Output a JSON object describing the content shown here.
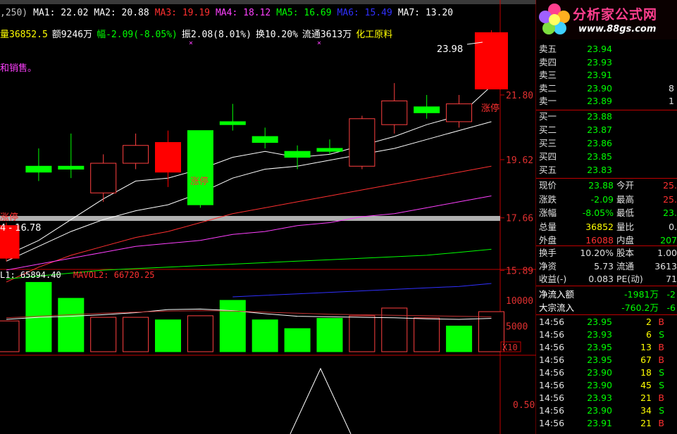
{
  "header": {
    "ma_items": [
      {
        "text": ",250)",
        "color": "#c0c0c0"
      },
      {
        "text": "MA1: 22.02",
        "color": "#ffffff"
      },
      {
        "text": "MA2: 20.88",
        "color": "#ffffff"
      },
      {
        "text": "MA3: 19.19",
        "color": "#ff3030"
      },
      {
        "text": "MA4: 18.12",
        "color": "#ff40ff"
      },
      {
        "text": "MA5: 16.69",
        "color": "#00ff00"
      },
      {
        "text": "MA6: 15.49",
        "color": "#3030ff"
      },
      {
        "text": "MA7: 13.20",
        "color": "#ffffff"
      }
    ],
    "info_items": [
      {
        "text": "量36852.5",
        "color": "#ffff00"
      },
      {
        "text": "额9246万",
        "color": "#ffffff"
      },
      {
        "text": "幅-2.09(-8.05%)",
        "color": "#00ff00"
      },
      {
        "text": "振2.08(8.01%)",
        "color": "#ffffff"
      },
      {
        "text": "换10.20%",
        "color": "#ffffff"
      },
      {
        "text": "流通3613万",
        "color": "#ffffff"
      },
      {
        "text": "化工原料",
        "color": "#ffff00"
      }
    ],
    "note": "和销售。"
  },
  "chart_data": {
    "type": "candlestick",
    "y_ticks": [
      "21.80",
      "19.62",
      "17.66",
      "15.89"
    ],
    "candles": [
      {
        "o": 17.4,
        "c": 16.3,
        "h": 17.5,
        "l": 16.2
      },
      {
        "o": 19.2,
        "c": 19.4,
        "h": 20.0,
        "l": 18.9
      },
      {
        "o": 19.3,
        "c": 19.4,
        "h": 20.5,
        "l": 19.0
      },
      {
        "o": 18.5,
        "c": 19.5,
        "h": 19.8,
        "l": 18.2
      },
      {
        "o": 19.5,
        "c": 20.1,
        "h": 20.5,
        "l": 19.3
      },
      {
        "o": 20.2,
        "c": 19.2,
        "h": 20.6,
        "l": 18.7
      },
      {
        "o": 18.1,
        "c": 20.6,
        "h": 20.6,
        "l": 18.0
      },
      {
        "o": 20.8,
        "c": 20.9,
        "h": 21.5,
        "l": 20.6
      },
      {
        "o": 20.4,
        "c": 20.2,
        "h": 20.7,
        "l": 20.0
      },
      {
        "o": 19.7,
        "c": 19.9,
        "h": 20.1,
        "l": 19.3
      },
      {
        "o": 19.9,
        "c": 20.0,
        "h": 20.3,
        "l": 19.8
      },
      {
        "o": 19.4,
        "c": 21.0,
        "h": 21.1,
        "l": 19.3
      },
      {
        "o": 20.8,
        "c": 21.6,
        "h": 22.2,
        "l": 20.5
      },
      {
        "o": 21.4,
        "c": 21.2,
        "h": 21.8,
        "l": 21.0
      },
      {
        "o": 20.9,
        "c": 21.5,
        "h": 21.8,
        "l": 20.7
      },
      {
        "o": 22.0,
        "c": 23.9,
        "h": 23.98,
        "l": 22.0
      }
    ],
    "candle_colors": [
      "#ff0000",
      "#00ff00",
      "#00ff00",
      "#ff4040",
      "#ff4040",
      "#ff0000",
      "#00ff00",
      "#00ff00",
      "#00ff00",
      "#00ff00",
      "#00ff00",
      "#ff4040",
      "#ff4040",
      "#00ff00",
      "#ff4040",
      "#ff0000"
    ],
    "candle_filled": [
      true,
      true,
      true,
      false,
      false,
      true,
      true,
      true,
      true,
      true,
      true,
      false,
      false,
      true,
      false,
      true
    ],
    "ma_lines": [
      {
        "color": "#ffffff",
        "values": [
          16.4,
          16.9,
          17.6,
          18.3,
          18.9,
          19.0,
          19.3,
          19.7,
          19.9,
          19.7,
          19.8,
          20.1,
          20.4,
          20.8,
          21.1,
          22.1
        ]
      },
      {
        "color": "#ffffff",
        "values": [
          16.2,
          16.7,
          17.2,
          17.6,
          17.9,
          18.1,
          18.5,
          19.0,
          19.3,
          19.4,
          19.6,
          19.8,
          20.0,
          20.3,
          20.6,
          20.9
        ]
      },
      {
        "color": "#ff3030",
        "values": [
          15.5,
          16.0,
          16.4,
          16.7,
          17.0,
          17.2,
          17.5,
          17.8,
          18.0,
          18.2,
          18.4,
          18.6,
          18.8,
          19.0,
          19.2,
          19.4
        ]
      },
      {
        "color": "#ff40ff",
        "values": [
          15.9,
          16.1,
          16.3,
          16.5,
          16.7,
          16.8,
          16.9,
          17.1,
          17.2,
          17.4,
          17.5,
          17.7,
          17.8,
          18.0,
          18.2,
          18.4
        ]
      },
      {
        "color": "#00ff00",
        "values": [
          15.6,
          15.7,
          15.8,
          15.9,
          15.95,
          16.0,
          16.05,
          16.1,
          16.15,
          16.2,
          16.25,
          16.3,
          16.35,
          16.4,
          16.5,
          16.6
        ]
      },
      {
        "color": "#3030ff",
        "values": [
          null,
          null,
          null,
          null,
          null,
          null,
          null,
          15.0,
          15.05,
          15.1,
          15.15,
          15.2,
          15.25,
          15.3,
          15.35,
          15.45
        ]
      }
    ],
    "annotations": [
      "23.98",
      "涨停",
      "涨停",
      "4 - 16.78",
      "涨停"
    ],
    "volume": {
      "label_vol": "L1: 65894.40",
      "label_mavol": "MAVOL2: 66720.25",
      "y_ticks": [
        "10000",
        "5000"
      ],
      "unit": "X10",
      "values": [
        6000,
        13500,
        10400,
        6700,
        6700,
        6200,
        7000,
        10000,
        6200,
        4500,
        6500,
        7000,
        8500,
        6600,
        5000,
        7800
      ],
      "colors": [
        "#ff4040",
        "#00ff00",
        "#00ff00",
        "#ff4040",
        "#ff4040",
        "#00ff00",
        "#ff4040",
        "#00ff00",
        "#00ff00",
        "#00ff00",
        "#00ff00",
        "#ff4040",
        "#ff4040",
        "#ff4040",
        "#00ff00",
        "#ff4040"
      ],
      "filled": [
        false,
        true,
        true,
        false,
        false,
        true,
        false,
        true,
        true,
        true,
        true,
        false,
        false,
        false,
        true,
        false
      ]
    },
    "indicator": {
      "y_ticks": [
        "0.50"
      ]
    }
  },
  "panel": {
    "logo_title": "分析家公式网",
    "logo_url": "www.88gs.com",
    "sell_orders": [
      {
        "label": "卖五",
        "price": "23.94",
        "vol": ""
      },
      {
        "label": "卖四",
        "price": "23.93",
        "vol": ""
      },
      {
        "label": "卖三",
        "price": "23.91",
        "vol": ""
      },
      {
        "label": "卖二",
        "price": "23.90",
        "vol": "8"
      },
      {
        "label": "卖一",
        "price": "23.89",
        "vol": "1"
      }
    ],
    "buy_orders": [
      {
        "label": "买一",
        "price": "23.88",
        "vol": ""
      },
      {
        "label": "买二",
        "price": "23.87",
        "vol": ""
      },
      {
        "label": "买三",
        "price": "23.86",
        "vol": ""
      },
      {
        "label": "买四",
        "price": "23.85",
        "vol": ""
      },
      {
        "label": "买五",
        "price": "23.83",
        "vol": ""
      }
    ],
    "quote": [
      {
        "l1": "现价",
        "v1": "23.88",
        "c1": "#00ff00",
        "l2": "今开",
        "v2": "25.",
        "c2": "#ff3030"
      },
      {
        "l1": "涨跌",
        "v1": "-2.09",
        "c1": "#00ff00",
        "l2": "最高",
        "v2": "25.",
        "c2": "#ff3030"
      },
      {
        "l1": "涨幅",
        "v1": "-8.05%",
        "c1": "#00ff00",
        "l2": "最低",
        "v2": "23.",
        "c2": "#00ff00"
      },
      {
        "l1": "总量",
        "v1": "36852",
        "c1": "#ffff00",
        "l2": "量比",
        "v2": "0.",
        "c2": "#e0e0e0"
      },
      {
        "l1": "外盘",
        "v1": "16088",
        "c1": "#ff3030",
        "l2": "内盘",
        "v2": "207",
        "c2": "#00ff00"
      }
    ],
    "fund": [
      {
        "l1": "换手",
        "v1": "10.20%",
        "l2": "股本",
        "v2": "1.00"
      },
      {
        "l1": "净资",
        "v1": "5.73",
        "l2": "流通",
        "v2": "3613"
      },
      {
        "l1": "收益(-)",
        "v1": "0.083",
        "l2": "PE(动)",
        "v2": "71"
      }
    ],
    "flow": [
      {
        "label": "净流入额",
        "value": "-1981万",
        "extra": "-2"
      },
      {
        "label": "大宗流入",
        "value": "-760.2万",
        "extra": "-6"
      }
    ],
    "ticks": [
      {
        "time": "14:56",
        "price": "23.95",
        "vol": "2",
        "side": "B"
      },
      {
        "time": "14:56",
        "price": "23.93",
        "vol": "6",
        "side": "S"
      },
      {
        "time": "14:56",
        "price": "23.95",
        "vol": "13",
        "side": "B"
      },
      {
        "time": "14:56",
        "price": "23.95",
        "vol": "67",
        "side": "B"
      },
      {
        "time": "14:56",
        "price": "23.90",
        "vol": "18",
        "side": "S"
      },
      {
        "time": "14:56",
        "price": "23.90",
        "vol": "45",
        "side": "S"
      },
      {
        "time": "14:56",
        "price": "23.93",
        "vol": "21",
        "side": "B"
      },
      {
        "time": "14:56",
        "price": "23.90",
        "vol": "34",
        "side": "S"
      },
      {
        "time": "14:56",
        "price": "23.91",
        "vol": "21",
        "side": "B"
      }
    ]
  }
}
